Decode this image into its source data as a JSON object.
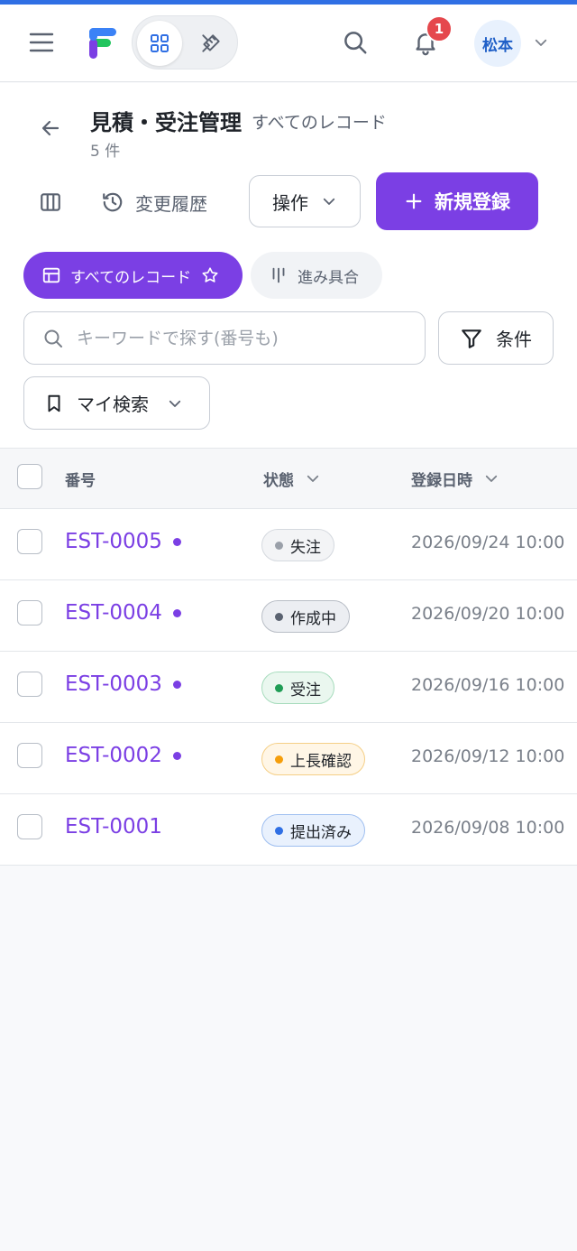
{
  "header": {
    "notification_count": "1",
    "user_name": "松本",
    "colors": {
      "accent": "#7b3fe4",
      "top_strip": "#2f6fe4",
      "badge": "#e5484d"
    }
  },
  "page": {
    "title": "見積・受注管理",
    "subtitle": "すべてのレコード",
    "count": "5 件"
  },
  "toolbar": {
    "history_label": "変更履歴",
    "operations_label": "操作",
    "new_label": "新規登録"
  },
  "views": {
    "active_label": "すべてのレコード",
    "progress_label": "進み具合"
  },
  "search": {
    "placeholder": "キーワードで探す(番号も)",
    "conditions_label": "条件",
    "my_search_label": "マイ検索"
  },
  "table": {
    "headers": {
      "number": "番号",
      "status": "状態",
      "registered_at": "登録日時"
    },
    "rows": [
      {
        "id": "EST-0005",
        "status": "失注",
        "date": "2026/09/24 10:00",
        "unread": true,
        "status_color": "#9aa0a9",
        "pill_bg": "#f3f4f6",
        "pill_border": "#d5d9df"
      },
      {
        "id": "EST-0004",
        "status": "作成中",
        "date": "2026/09/20 10:00",
        "unread": true,
        "status_color": "#5a6270",
        "pill_bg": "#eceef2",
        "pill_border": "#b9bec6"
      },
      {
        "id": "EST-0003",
        "status": "受注",
        "date": "2026/09/16 10:00",
        "unread": true,
        "status_color": "#1f9d55",
        "pill_bg": "#eaf7ef",
        "pill_border": "#a7dcbd"
      },
      {
        "id": "EST-0002",
        "status": "上長確認",
        "date": "2026/09/12 10:00",
        "unread": true,
        "status_color": "#f59e0b",
        "pill_bg": "#fff6e6",
        "pill_border": "#f5cf86"
      },
      {
        "id": "EST-0001",
        "status": "提出済み",
        "date": "2026/09/08 10:00",
        "unread": false,
        "status_color": "#2f6fe4",
        "pill_bg": "#e9f1fd",
        "pill_border": "#9fbff0"
      }
    ]
  }
}
